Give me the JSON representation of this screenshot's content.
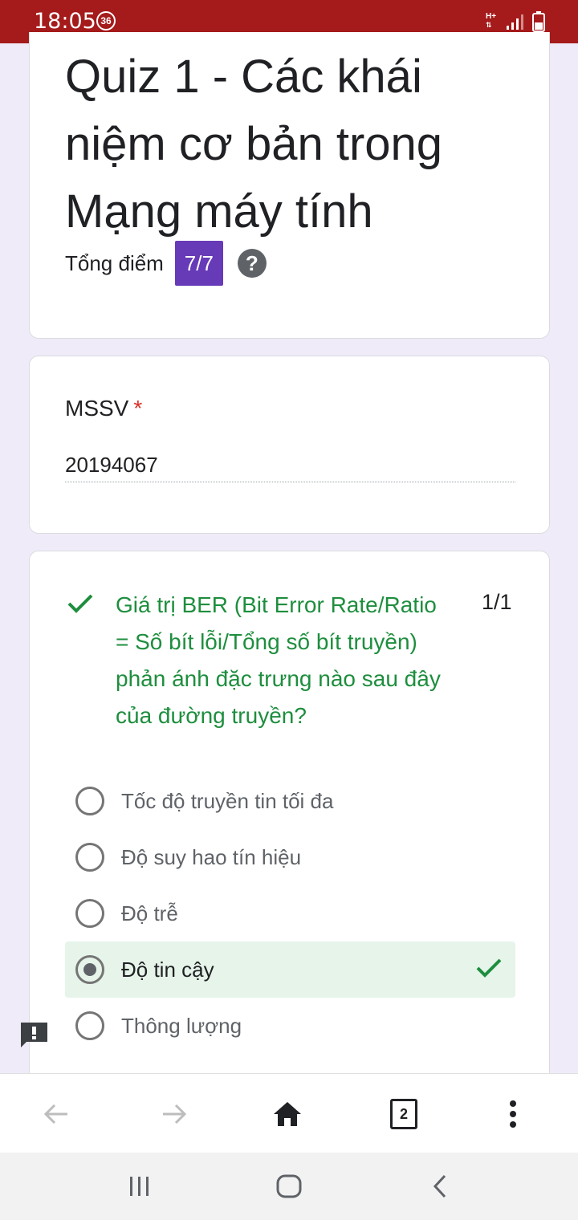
{
  "status_bar": {
    "time": "18:05",
    "badge": "36",
    "network": "H+"
  },
  "quiz": {
    "title": "Quiz 1 - Các khái niệm cơ bản trong Mạng máy tính",
    "score_label": "Tổng điểm",
    "score_value": "7/7"
  },
  "mssv": {
    "label": "MSSV",
    "required_mark": "*",
    "value": "20194067"
  },
  "question": {
    "text": "Giá trị BER (Bit Error Rate/Ratio = Số bít lỗi/Tổng số bít truyền) phản ánh đặc trưng nào sau đây của đường truyền?",
    "points": "1/1",
    "status_color": "#1e8e3e",
    "options": [
      {
        "label": "Tốc độ truyền tin tối đa",
        "selected": false
      },
      {
        "label": "Độ suy hao tín hiệu",
        "selected": false
      },
      {
        "label": "Độ trễ",
        "selected": false
      },
      {
        "label": "Độ tin cậy",
        "selected": true,
        "correct": true
      },
      {
        "label": "Thông lượng",
        "selected": false
      }
    ]
  },
  "browser": {
    "tab_count": "2"
  },
  "colors": {
    "status_bar": "#a51a1a",
    "accent": "#673ab7",
    "page_bg": "#f0ebf8",
    "correct_bg": "#e6f4ea"
  }
}
